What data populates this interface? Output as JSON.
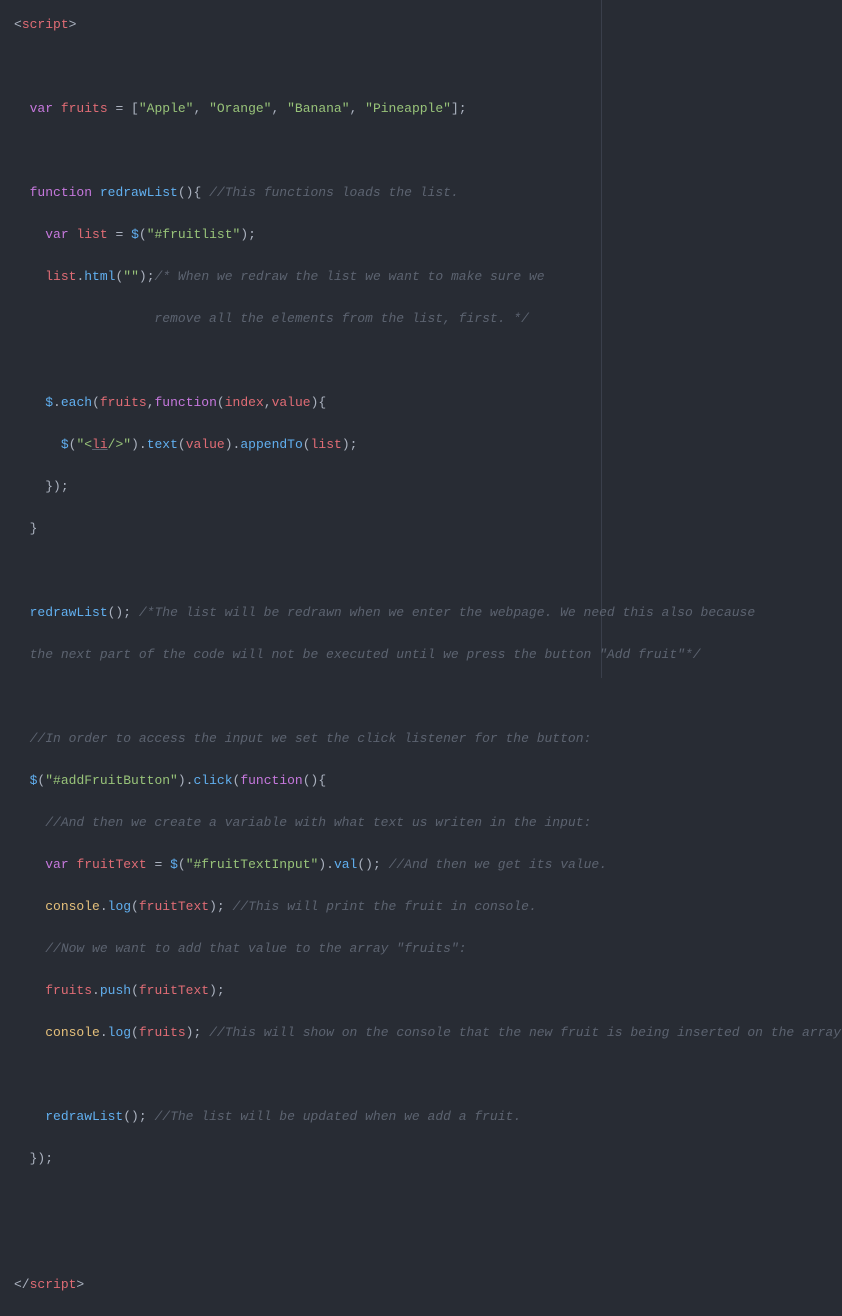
{
  "code": {
    "tag_open_bracket": "<",
    "tag_script": "script",
    "tag_close_bracket": ">",
    "tag_close_open": "</",
    "kw_var": "var",
    "kw_function": "function",
    "fruits_name": "fruits",
    "eq": " = ",
    "arr_open": "[",
    "arr_close": "]",
    "fruit1": "\"Apple\"",
    "fruit2": "\"Orange\"",
    "fruit3": "\"Banana\"",
    "fruit4": "\"Pineapple\"",
    "semi": ";",
    "comma": ", ",
    "fn_redrawList": "redrawList",
    "parens_empty": "()",
    "brace_open": "{",
    "brace_close": "}",
    "comment_loads": "//This functions loads the list.",
    "list_name": "list",
    "dollar": "$",
    "paren_open": "(",
    "paren_close": ")",
    "sel_fruitlist": "\"#fruitlist\"",
    "method_html": "html",
    "empty_str": "\"\"",
    "comment_redraw1": "/* When we redraw the list we want to make sure we",
    "comment_redraw2": "                  remove all the elements from the list, first. */",
    "method_each": "each",
    "dot": ".",
    "index": "index",
    "value": "value",
    "li_open_q": "\"<",
    "li_tag": "li",
    "li_close_q": "/>\"",
    "method_text": "text",
    "method_appendTo": "appendTo",
    "close_paren_semi": ");",
    "comment_redrawn1": "/*The list will be redrawn when we enter the webpage. We need this also because",
    "comment_redrawn2": "the next part of the code will not be executed until we press the button \"Add fruit\"*/",
    "comment_access": "//In order to access the input we set the click listener for the button:",
    "sel_addFruitButton": "\"#addFruitButton\"",
    "method_click": "click",
    "comment_createvar": "//And then we create a variable with what text us writen in the input:",
    "fruitText_name": "fruitText",
    "sel_fruitTextInput": "\"#fruitTextInput\"",
    "method_val": "val",
    "comment_getvalue": "//And then we get its value.",
    "console": "console",
    "method_log": "log",
    "comment_printfruit": "//This will print the fruit in console.",
    "comment_nowadd": "//Now we want to add that value to the array \"fruits\":",
    "method_push": "push",
    "comment_showconsole": "//This will show on the console that the new fruit is being inserted on the array.",
    "comment_updated": "//The list will be updated when we add a fruit."
  }
}
